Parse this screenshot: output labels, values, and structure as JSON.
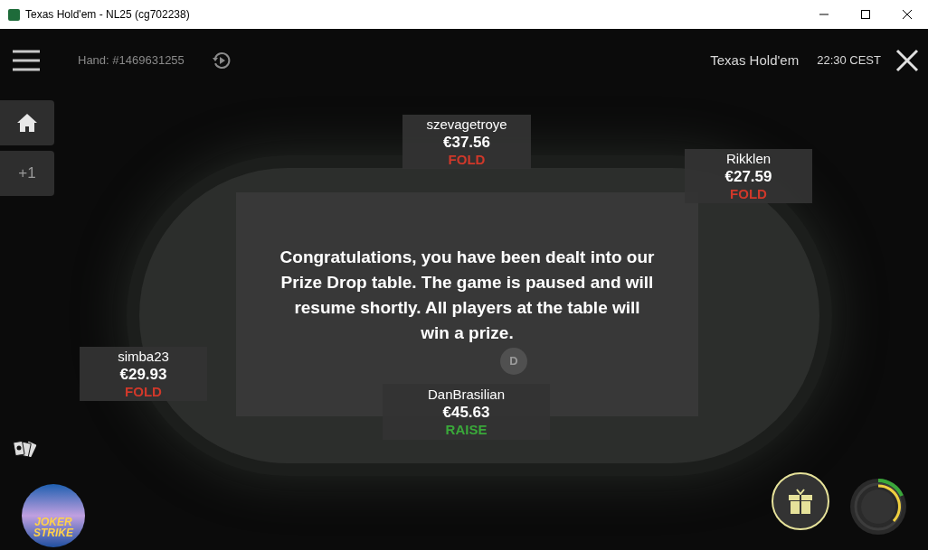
{
  "window": {
    "title": "Texas Hold'em - NL25 (cg702238)"
  },
  "top_bar": {
    "hand": "Hand: #1469631255",
    "game": "Texas Hold'em",
    "time": "22:30 CEST"
  },
  "side_buttons": [
    {
      "kind": "home"
    },
    {
      "kind": "text",
      "label": "+1"
    }
  ],
  "players": [
    {
      "name": "szevagetroye",
      "stack": "€37.56",
      "action": "FOLD",
      "color": "#d0382a"
    },
    {
      "name": "Rikklen",
      "stack": "€27.59",
      "action": "FOLD",
      "color": "#d0382a"
    },
    {
      "name": "simba23",
      "stack": "€29.93",
      "action": "FOLD",
      "color": "#d0382a"
    },
    {
      "name": "DanBrasilian",
      "stack": "€45.63",
      "action": "RAISE",
      "color": "#3aa83a"
    }
  ],
  "dealer_button": "D",
  "message": "Congratulations, you have been dealt into our Prize Drop table. The game is paused and will resume shortly. All players at the table will win a prize.",
  "promo": {
    "line_1": "JOKER",
    "line_2": "STRIKE"
  }
}
